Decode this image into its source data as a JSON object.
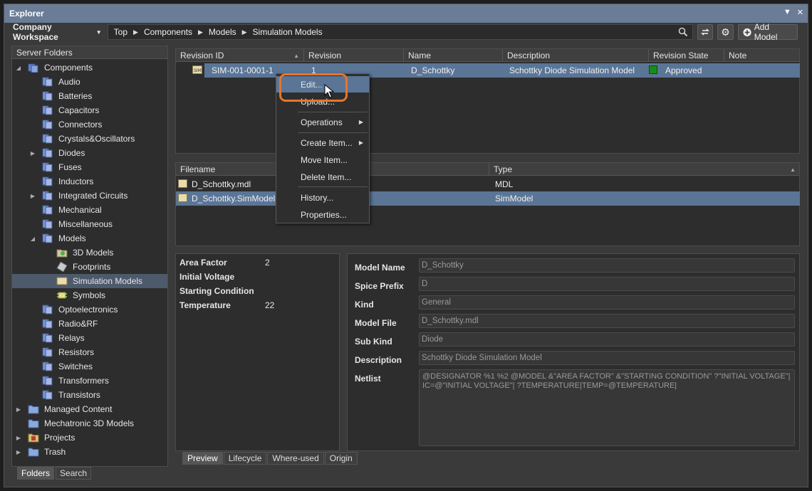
{
  "window": {
    "title": "Explorer"
  },
  "toolbar": {
    "workspace": "Company Workspace",
    "breadcrumbs": [
      "Top",
      "Components",
      "Models",
      "Simulation Models"
    ],
    "add_model": "Add Model"
  },
  "server_folders": {
    "header": "Server Folders",
    "items": [
      {
        "label": "Components",
        "level": 0,
        "expanded": true,
        "icon": "components-icon"
      },
      {
        "label": "Audio",
        "level": 1,
        "icon": "folder-icon"
      },
      {
        "label": "Batteries",
        "level": 1,
        "icon": "folder-icon"
      },
      {
        "label": "Capacitors",
        "level": 1,
        "icon": "folder-icon"
      },
      {
        "label": "Connectors",
        "level": 1,
        "icon": "folder-icon"
      },
      {
        "label": "Crystals&Oscillators",
        "level": 1,
        "icon": "folder-icon"
      },
      {
        "label": "Diodes",
        "level": 1,
        "collapsed": true,
        "icon": "folder-icon"
      },
      {
        "label": "Fuses",
        "level": 1,
        "icon": "folder-icon"
      },
      {
        "label": "Inductors",
        "level": 1,
        "icon": "folder-icon"
      },
      {
        "label": "Integrated Circuits",
        "level": 1,
        "collapsed": true,
        "icon": "folder-icon"
      },
      {
        "label": "Mechanical",
        "level": 1,
        "icon": "folder-icon"
      },
      {
        "label": "Miscellaneous",
        "level": 1,
        "icon": "folder-icon"
      },
      {
        "label": "Models",
        "level": 1,
        "expanded": true,
        "icon": "folder-icon"
      },
      {
        "label": "3D Models",
        "level": 2,
        "icon": "3d-model-icon"
      },
      {
        "label": "Footprints",
        "level": 2,
        "icon": "footprint-icon"
      },
      {
        "label": "Simulation Models",
        "level": 2,
        "selected": true,
        "icon": "sim-model-icon"
      },
      {
        "label": "Symbols",
        "level": 2,
        "icon": "symbol-icon"
      },
      {
        "label": "Optoelectronics",
        "level": 1,
        "icon": "folder-icon"
      },
      {
        "label": "Radio&RF",
        "level": 1,
        "icon": "folder-icon"
      },
      {
        "label": "Relays",
        "level": 1,
        "icon": "folder-icon"
      },
      {
        "label": "Resistors",
        "level": 1,
        "icon": "folder-icon"
      },
      {
        "label": "Switches",
        "level": 1,
        "icon": "folder-icon"
      },
      {
        "label": "Transformers",
        "level": 1,
        "icon": "folder-icon"
      },
      {
        "label": "Transistors",
        "level": 1,
        "icon": "folder-icon"
      },
      {
        "label": "Managed Content",
        "level": 0,
        "collapsed": true,
        "icon": "plain-folder-icon"
      },
      {
        "label": "Mechatronic 3D Models",
        "level": 0,
        "icon": "plain-folder-icon"
      },
      {
        "label": "Projects",
        "level": 0,
        "collapsed": true,
        "icon": "projects-icon"
      },
      {
        "label": "Trash",
        "level": 0,
        "collapsed": true,
        "icon": "plain-folder-icon"
      }
    ]
  },
  "folder_tabs": [
    "Folders",
    "Search"
  ],
  "revisions": {
    "columns": [
      "Revision ID",
      "Revision",
      "Name",
      "Description",
      "Revision State",
      "Note"
    ],
    "row": {
      "revision_id": "SIM-001-0001-1",
      "revision": "1",
      "name": "D_Schottky",
      "description": "Schottky Diode Simulation Model",
      "state": "Approved",
      "state_color": "#1a8c1a"
    }
  },
  "files": {
    "columns": [
      "Filename",
      "Type"
    ],
    "rows": [
      {
        "filename": "D_Schottky.mdl",
        "type": "MDL"
      },
      {
        "filename": "D_Schottky.SimModel",
        "type": "SimModel"
      }
    ]
  },
  "preview": {
    "params": [
      {
        "name": "Area Factor",
        "value": "2"
      },
      {
        "name": "Initial Voltage",
        "value": ""
      },
      {
        "name": "Starting Condition",
        "value": ""
      },
      {
        "name": "Temperature",
        "value": "22"
      }
    ]
  },
  "details": {
    "fields": [
      {
        "label": "Model Name",
        "value": "D_Schottky"
      },
      {
        "label": "Spice Prefix",
        "value": "D"
      },
      {
        "label": "Kind",
        "value": "General"
      },
      {
        "label": "Model File",
        "value": "D_Schottky.mdl"
      },
      {
        "label": "Sub Kind",
        "value": "Diode"
      },
      {
        "label": "Description",
        "value": "Schottky Diode Simulation Model"
      }
    ],
    "netlist_label": "Netlist",
    "netlist": "@DESIGNATOR %1 %2 @MODEL &\"AREA FACTOR\" &\"STARTING CONDITION\" ?\"INITIAL VOLTAGE\"| IC=@\"INITIAL VOLTAGE\"| ?TEMPERATURE|TEMP=@TEMPERATURE|"
  },
  "bottom_tabs": [
    "Preview",
    "Lifecycle",
    "Where-used",
    "Origin"
  ],
  "context_menu": {
    "items": [
      "Edit...",
      "Upload...",
      "Operations",
      "Create Item...",
      "Move Item...",
      "Delete Item...",
      "History...",
      "Properties..."
    ]
  },
  "colors": {
    "accent": "#5a7596",
    "callout": "#e8752a",
    "titlebar": "#6a7c96"
  }
}
